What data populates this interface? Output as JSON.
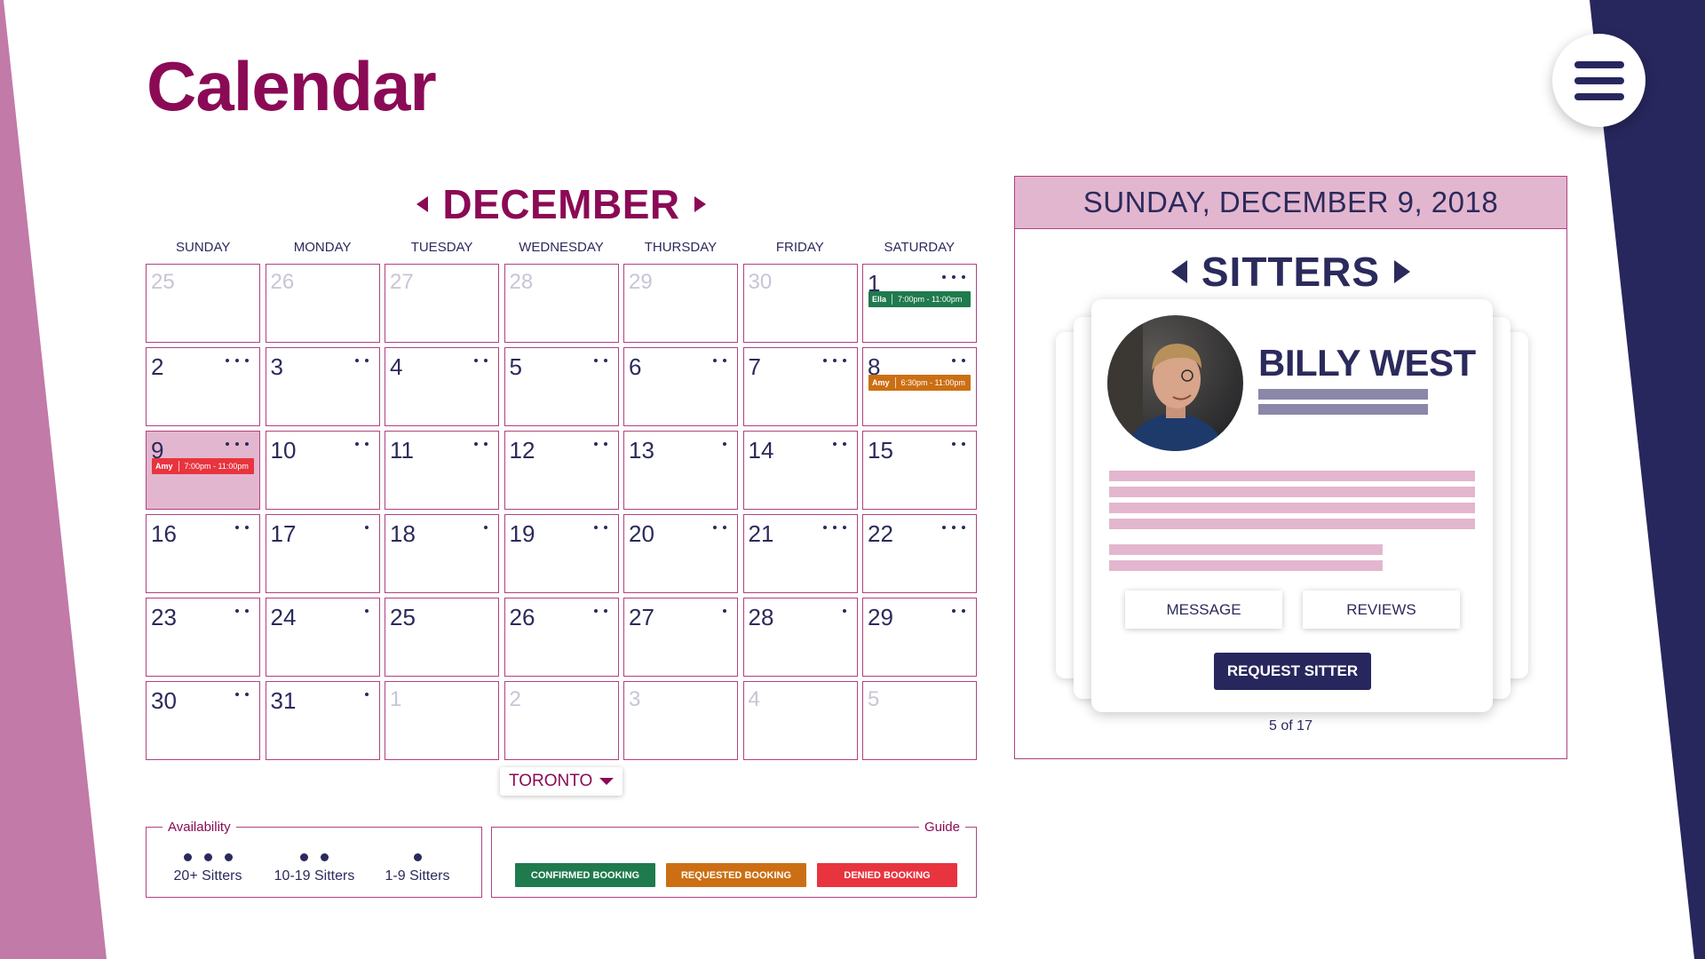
{
  "colors": {
    "brand": "#8b0a55",
    "navy": "#27275e",
    "pink": "#e3b6cf",
    "confirmed": "#1f7a4d",
    "requested": "#cc6f14",
    "denied": "#e8343e"
  },
  "title": "Calendar",
  "menu": {
    "icon": "hamburger-menu-icon"
  },
  "calendar": {
    "month": "DECEMBER",
    "weekdays": [
      "SUNDAY",
      "MONDAY",
      "TUESDAY",
      "WEDNESDAY",
      "THURSDAY",
      "FRIDAY",
      "SATURDAY"
    ],
    "days": [
      {
        "n": "25",
        "muted": true,
        "dots": 0
      },
      {
        "n": "26",
        "muted": true,
        "dots": 0
      },
      {
        "n": "27",
        "muted": true,
        "dots": 0
      },
      {
        "n": "28",
        "muted": true,
        "dots": 0
      },
      {
        "n": "29",
        "muted": true,
        "dots": 0
      },
      {
        "n": "30",
        "muted": true,
        "dots": 0
      },
      {
        "n": "1",
        "dots": 3,
        "booking": {
          "name": "Ella",
          "time": "7:00pm - 11:00pm",
          "status": "confirmed"
        }
      },
      {
        "n": "2",
        "dots": 3
      },
      {
        "n": "3",
        "dots": 2
      },
      {
        "n": "4",
        "dots": 2
      },
      {
        "n": "5",
        "dots": 2
      },
      {
        "n": "6",
        "dots": 2
      },
      {
        "n": "7",
        "dots": 3
      },
      {
        "n": "8",
        "dots": 2,
        "booking": {
          "name": "Amy",
          "time": "6:30pm - 11:00pm",
          "status": "requested"
        }
      },
      {
        "n": "9",
        "dots": 3,
        "selected": true,
        "booking": {
          "name": "Amy",
          "time": "7:00pm - 11:00pm",
          "status": "denied"
        }
      },
      {
        "n": "10",
        "dots": 2
      },
      {
        "n": "11",
        "dots": 2
      },
      {
        "n": "12",
        "dots": 2
      },
      {
        "n": "13",
        "dots": 1
      },
      {
        "n": "14",
        "dots": 2
      },
      {
        "n": "15",
        "dots": 2
      },
      {
        "n": "16",
        "dots": 2
      },
      {
        "n": "17",
        "dots": 1
      },
      {
        "n": "18",
        "dots": 1
      },
      {
        "n": "19",
        "dots": 2
      },
      {
        "n": "20",
        "dots": 2
      },
      {
        "n": "21",
        "dots": 3
      },
      {
        "n": "22",
        "dots": 3
      },
      {
        "n": "23",
        "dots": 2
      },
      {
        "n": "24",
        "dots": 1
      },
      {
        "n": "25",
        "dots": 0
      },
      {
        "n": "26",
        "dots": 2
      },
      {
        "n": "27",
        "dots": 1
      },
      {
        "n": "28",
        "dots": 1
      },
      {
        "n": "29",
        "dots": 2
      },
      {
        "n": "30",
        "dots": 2
      },
      {
        "n": "31",
        "dots": 1
      },
      {
        "n": "1",
        "muted": true,
        "dots": 0
      },
      {
        "n": "2",
        "muted": true,
        "dots": 0
      },
      {
        "n": "3",
        "muted": true,
        "dots": 0
      },
      {
        "n": "4",
        "muted": true,
        "dots": 0
      },
      {
        "n": "5",
        "muted": true,
        "dots": 0
      }
    ]
  },
  "location": {
    "selected": "TORONTO"
  },
  "availability": {
    "legend": "Availability",
    "items": [
      {
        "dots": 3,
        "label": "20+ Sitters"
      },
      {
        "dots": 2,
        "label": "10-19 Sitters"
      },
      {
        "dots": 1,
        "label": "1-9 Sitters"
      }
    ]
  },
  "guide": {
    "legend": "Guide",
    "items": [
      {
        "label": "CONFIRMED BOOKING",
        "status": "confirmed"
      },
      {
        "label": "REQUESTED BOOKING",
        "status": "requested"
      },
      {
        "label": "DENIED BOOKING",
        "status": "denied"
      }
    ]
  },
  "panel": {
    "date": "SUNDAY, DECEMBER 9, 2018",
    "heading": "SITTERS",
    "sitter": {
      "name": "BILLY WEST"
    },
    "message_label": "MESSAGE",
    "reviews_label": "REVIEWS",
    "request_label": "REQUEST SITTER",
    "pager": "5 of 17"
  }
}
